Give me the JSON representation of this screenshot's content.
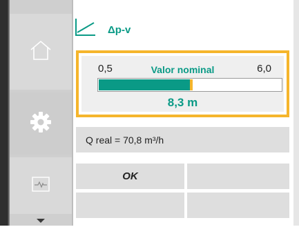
{
  "header": {
    "icon": "curve-icon",
    "title": "Δp-v"
  },
  "setpoint": {
    "min_label": "0,5",
    "max_label": "6,0",
    "title": "Valor nominal",
    "value_text": "8,3 m",
    "fill_fraction": 0.5
  },
  "info": {
    "q_real": "Q real = 70,8 m³/h"
  },
  "actions": {
    "ok_label": "OK"
  },
  "sidebar": {
    "items": [
      {
        "icon": "home-icon"
      },
      {
        "icon": "gear-icon"
      },
      {
        "icon": "pulse-icon"
      }
    ],
    "more_icon": "chevron-down-icon"
  },
  "colors": {
    "accent": "#0a9a86",
    "highlight": "#f5b52c"
  }
}
